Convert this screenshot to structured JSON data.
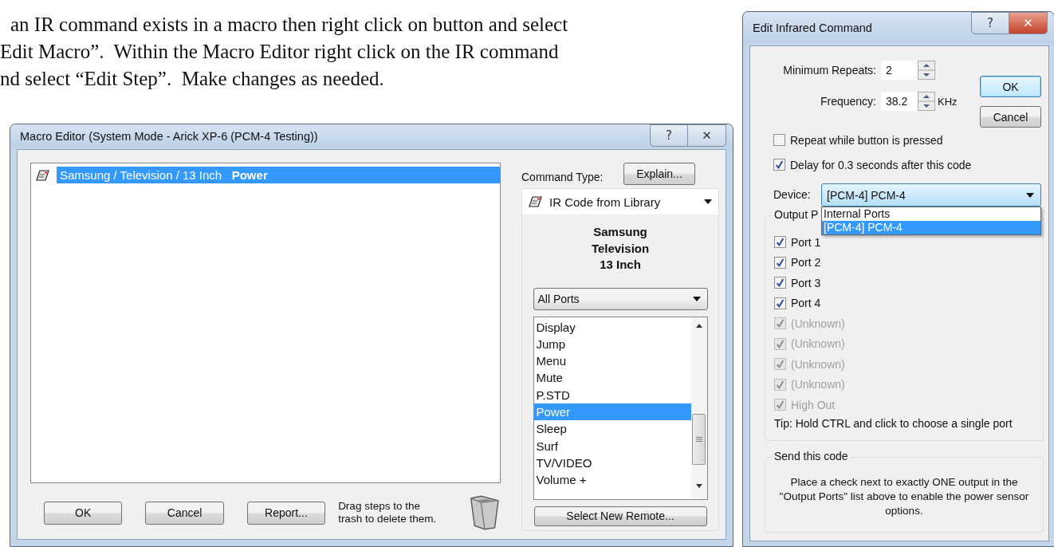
{
  "paragraph_lines": [
    "an IR command exists in a macro then right click on button and select",
    "Edit Macro”.  Within the Macro Editor right click on the IR command",
    "nd select “Edit Step”.  Make changes as needed."
  ],
  "macro_editor": {
    "title": "Macro Editor (System Mode - Arick XP-6 (PCM-4 Testing))",
    "help_glyph": "?",
    "close_glyph": "✕",
    "steps": [
      {
        "path": "Samsung / Television / 13 Inch",
        "command": "Power",
        "selected": true
      }
    ],
    "buttons": [
      "OK",
      "Cancel",
      "Report..."
    ],
    "hint": "Drag steps to the trash to delete them.",
    "command_type_label": "Command Type:",
    "explain_button": "Explain...",
    "command_type": "IR Code from Library",
    "remote_lines": [
      "Samsung",
      "Television",
      "13 Inch"
    ],
    "port_filter": "All Ports",
    "commands": [
      {
        "label": "Display",
        "selected": false
      },
      {
        "label": "Jump",
        "selected": false
      },
      {
        "label": "Menu",
        "selected": false
      },
      {
        "label": "Mute",
        "selected": false
      },
      {
        "label": "P.STD",
        "selected": false
      },
      {
        "label": "Power",
        "selected": true
      },
      {
        "label": "Sleep",
        "selected": false
      },
      {
        "label": "Surf",
        "selected": false
      },
      {
        "label": "TV/VIDEO",
        "selected": false
      },
      {
        "label": "Volume +",
        "selected": false
      }
    ],
    "select_remote_button": "Select New Remote..."
  },
  "ir_dialog": {
    "title": "Edit Infrared Command",
    "help_glyph": "?",
    "close_glyph": "✕",
    "min_repeats_label": "Minimum Repeats:",
    "min_repeats": "2",
    "frequency_label": "Frequency:",
    "frequency": "38.2",
    "frequency_unit": "KHz",
    "ok_button": "OK",
    "cancel_button": "Cancel",
    "options": [
      {
        "label": "Repeat while button is pressed",
        "checked": false
      },
      {
        "label": "Delay for 0.3 seconds after this code",
        "checked": true
      }
    ],
    "device_label": "Device:",
    "device": "[PCM-4] PCM-4",
    "device_options": [
      {
        "label": "Internal Ports",
        "selected": false
      },
      {
        "label": "[PCM-4] PCM-4",
        "selected": true
      }
    ],
    "output_ports_label": "Output P",
    "ports": [
      {
        "label": "Port 1",
        "checked": true,
        "disabled": false
      },
      {
        "label": "Port 2",
        "checked": true,
        "disabled": false
      },
      {
        "label": "Port 3",
        "checked": true,
        "disabled": false
      },
      {
        "label": "Port 4",
        "checked": true,
        "disabled": false
      },
      {
        "label": "(Unknown)",
        "checked": true,
        "disabled": true
      },
      {
        "label": "(Unknown)",
        "checked": true,
        "disabled": true
      },
      {
        "label": "(Unknown)",
        "checked": true,
        "disabled": true
      },
      {
        "label": "(Unknown)",
        "checked": true,
        "disabled": true
      },
      {
        "label": "High Out",
        "checked": true,
        "disabled": true
      }
    ],
    "tip": "Tip: Hold CTRL and click to choose a single port",
    "send_group_label": "Send this code",
    "send_note": "Place a check next to exactly ONE output in the \"Output Ports\" list above to enable the power sensor options."
  }
}
